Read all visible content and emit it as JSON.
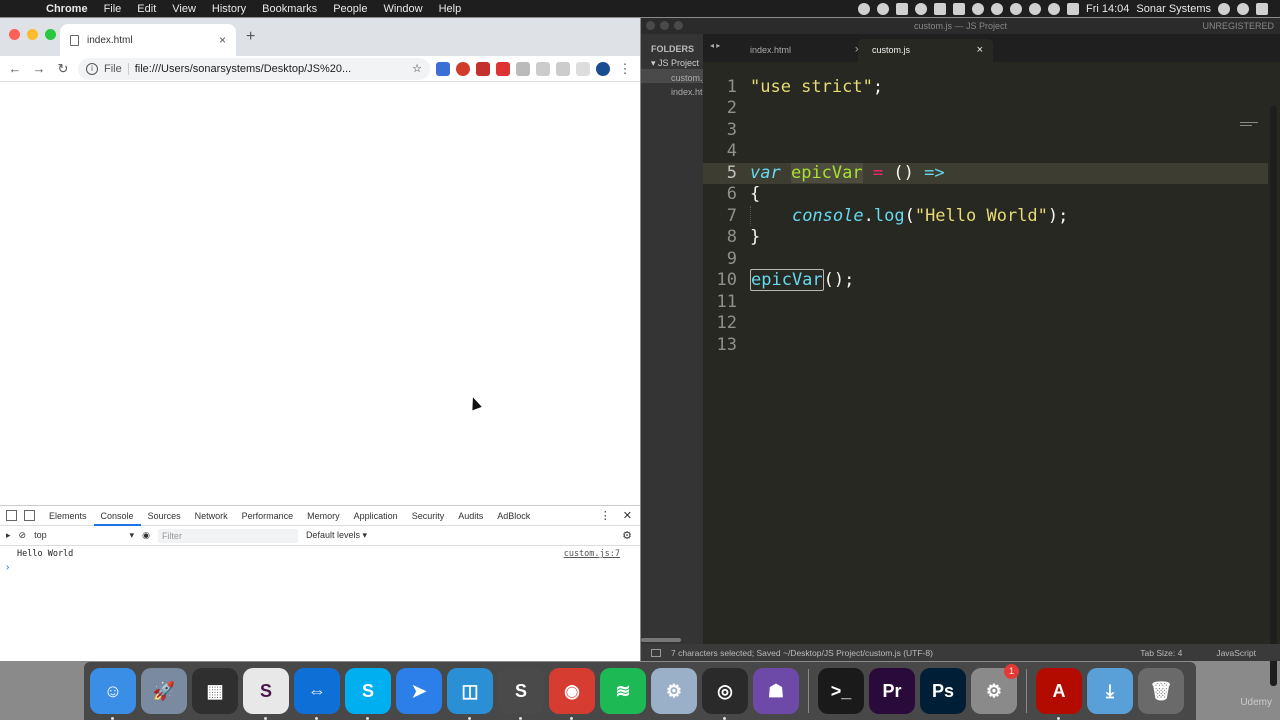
{
  "menubar": {
    "items": [
      "Chrome",
      "File",
      "Edit",
      "View",
      "History",
      "Bookmarks",
      "People",
      "Window",
      "Help"
    ],
    "clock": "Fri 14:04",
    "user": "Sonar Systems"
  },
  "chrome": {
    "tab_title": "index.html",
    "new_tab": "+",
    "omnibox_label": "File",
    "url": "file:///Users/sonarsystems/Desktop/JS%20..."
  },
  "devtools": {
    "tabs": [
      "Elements",
      "Console",
      "Sources",
      "Network",
      "Performance",
      "Memory",
      "Application",
      "Security",
      "Audits",
      "AdBlock"
    ],
    "active_tab": "Console",
    "context": "top",
    "filter_placeholder": "Filter",
    "levels": "Default levels ▾",
    "log_message": "Hello World",
    "log_source": "custom.js:7",
    "prompt": "›"
  },
  "sublime": {
    "window_title": "custom.js — JS Project",
    "unregistered": "UNREGISTERED",
    "sidebar_header": "FOLDERS",
    "sidebar_folder": "JS Project",
    "sidebar_files": [
      "custom.js",
      "index.html"
    ],
    "tabs": [
      {
        "label": "index.html",
        "active": false
      },
      {
        "label": "custom.js",
        "active": true
      }
    ],
    "current_line": 5,
    "line_numbers": [
      "1",
      "2",
      "3",
      "4",
      "5",
      "6",
      "7",
      "8",
      "9",
      "10",
      "11",
      "12",
      "13"
    ],
    "code": {
      "l1_str": "\"use strict\"",
      "l1_semi": ";",
      "l5_var": "var",
      "l5_name": "epicVar",
      "l5_eq": "=",
      "l5_parens": "()",
      "l5_arrow": "=>",
      "l6": "{",
      "l7_console": "console",
      "l7_dot": ".",
      "l7_log": "log",
      "l7_open": "(",
      "l7_str": "\"Hello World\"",
      "l7_close": ");",
      "l8": "}",
      "l10_name": "epicVar",
      "l10_rest": "();"
    },
    "status_text": "7 characters selected; Saved ~/Desktop/JS Project/custom.js (UTF-8)",
    "tab_size": "Tab Size: 4",
    "syntax": "JavaScript"
  },
  "dock": {
    "apps": [
      {
        "name": "finder",
        "glyph": "☺",
        "color": "#3a8ee6",
        "running": true
      },
      {
        "name": "launchpad",
        "glyph": "🚀",
        "color": "#7a8aa0",
        "running": false
      },
      {
        "name": "image-capture",
        "glyph": "▦",
        "color": "#2f2f2f",
        "running": false
      },
      {
        "name": "slack",
        "glyph": "S",
        "color": "#e8e8e8",
        "running": true
      },
      {
        "name": "teamviewer",
        "glyph": "⇔",
        "color": "#0e6fd6",
        "running": true
      },
      {
        "name": "skype",
        "glyph": "S",
        "color": "#00aff0",
        "running": true
      },
      {
        "name": "send-to-kindle",
        "glyph": "➤",
        "color": "#2c7ee8",
        "running": false
      },
      {
        "name": "sourcetree",
        "glyph": "◫",
        "color": "#2b8fd6",
        "running": true
      },
      {
        "name": "sublime-text",
        "glyph": "S",
        "color": "#4a4a4a",
        "running": true
      },
      {
        "name": "chrome",
        "glyph": "◉",
        "color": "#d63c2f",
        "running": true
      },
      {
        "name": "spotify",
        "glyph": "≋",
        "color": "#1db954",
        "running": false
      },
      {
        "name": "system-tool",
        "glyph": "⚙",
        "color": "#9ab0c8",
        "running": false
      },
      {
        "name": "obs",
        "glyph": "◎",
        "color": "#2a2a2a",
        "running": true
      },
      {
        "name": "github-desktop",
        "glyph": "☗",
        "color": "#6e4aa8",
        "running": false
      },
      {
        "name": "terminal",
        "glyph": ">_",
        "color": "#1a1a1a",
        "running": false
      },
      {
        "name": "premiere-pro",
        "glyph": "Pr",
        "color": "#2a0a3a",
        "running": false
      },
      {
        "name": "photoshop",
        "glyph": "Ps",
        "color": "#001e36",
        "running": false
      },
      {
        "name": "system-preferences",
        "glyph": "⚙",
        "color": "#8a8a8a",
        "running": false,
        "badge": "1"
      },
      {
        "name": "acrobat",
        "glyph": "A",
        "color": "#b30b00",
        "running": true
      },
      {
        "name": "downloads",
        "glyph": "⤓",
        "color": "#5aa0d8",
        "running": false
      },
      {
        "name": "trash",
        "glyph": "🗑",
        "color": "#6a6a6a",
        "running": false
      }
    ]
  },
  "watermark": "Udemy"
}
